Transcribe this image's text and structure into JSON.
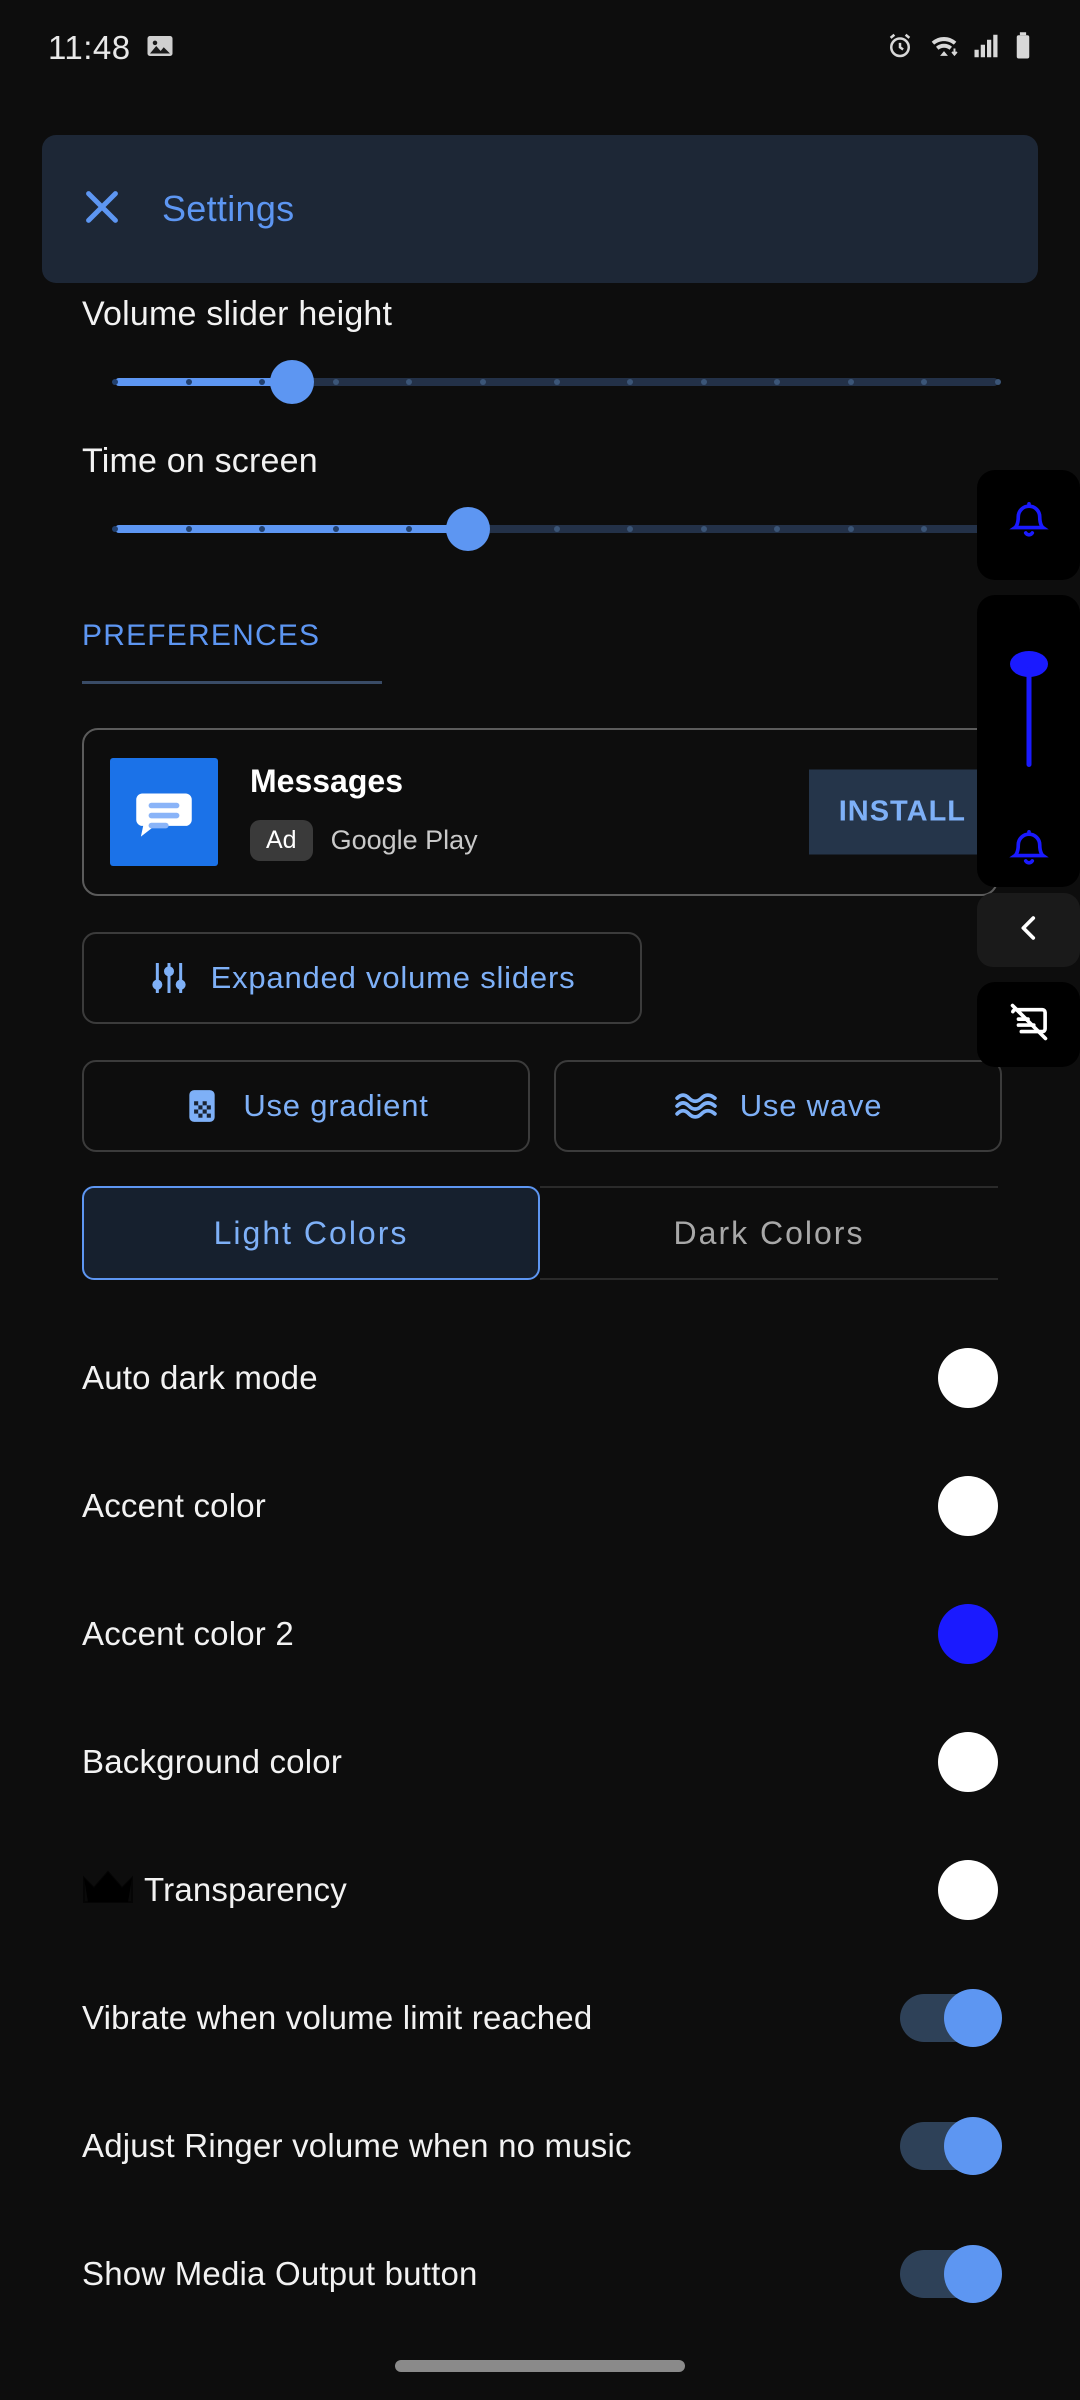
{
  "statusbar": {
    "time": "11:48",
    "icons": [
      "image-icon",
      "alarm-icon",
      "wifi-icon",
      "signal-icon",
      "battery-icon"
    ]
  },
  "header": {
    "close_icon": "close-icon",
    "title": "Settings"
  },
  "sliders": [
    {
      "label": "Volume slider height",
      "value_pct": 20,
      "ticks": 12
    },
    {
      "label": "Time on screen",
      "value_pct": 40,
      "ticks": 12
    }
  ],
  "section": {
    "title": "PREFERENCES"
  },
  "ad": {
    "app_name": "Messages",
    "badge": "Ad",
    "source": "Google Play",
    "install_label": "INSTALL",
    "icon": "messages-icon",
    "icon_bg": "#1b72e8"
  },
  "pills": [
    {
      "label": "Expanded volume sliders",
      "icon": "sliders-icon"
    },
    {
      "label": "Use gradient",
      "icon": "gradient-icon"
    },
    {
      "label": "Use wave",
      "icon": "wave-icon"
    }
  ],
  "segmented": {
    "options": [
      {
        "label": "Light Colors",
        "active": true
      },
      {
        "label": "Dark Colors",
        "active": false
      }
    ]
  },
  "rows": [
    {
      "label": "Auto dark mode",
      "control": "swatch",
      "color": "#ffffff",
      "crown": false
    },
    {
      "label": "Accent color",
      "control": "swatch",
      "color": "#ffffff",
      "crown": false
    },
    {
      "label": "Accent color 2",
      "control": "swatch",
      "color": "#1a1aff",
      "crown": false
    },
    {
      "label": "Background color",
      "control": "swatch",
      "color": "#ffffff",
      "crown": false
    },
    {
      "label": "Transparency",
      "control": "swatch",
      "color": "#ffffff",
      "crown": true
    },
    {
      "label": "Vibrate when volume limit reached",
      "control": "toggle",
      "on": true,
      "crown": false
    },
    {
      "label": "Adjust Ringer volume when no music",
      "control": "toggle",
      "on": true,
      "crown": false
    },
    {
      "label": "Show Media Output button",
      "control": "toggle",
      "on": true,
      "crown": false
    }
  ],
  "overlay": {
    "bell_top_icon": "bell-icon",
    "bell_bottom_icon": "bell-icon",
    "collapse_icon": "chevron-left-icon",
    "media_output_icon": "media-output-off-icon",
    "accent": "#1a1aff"
  },
  "colors": {
    "accent_blue": "#5d96f2",
    "bg": "#0d0d0d",
    "header_card": "#1d2736"
  }
}
